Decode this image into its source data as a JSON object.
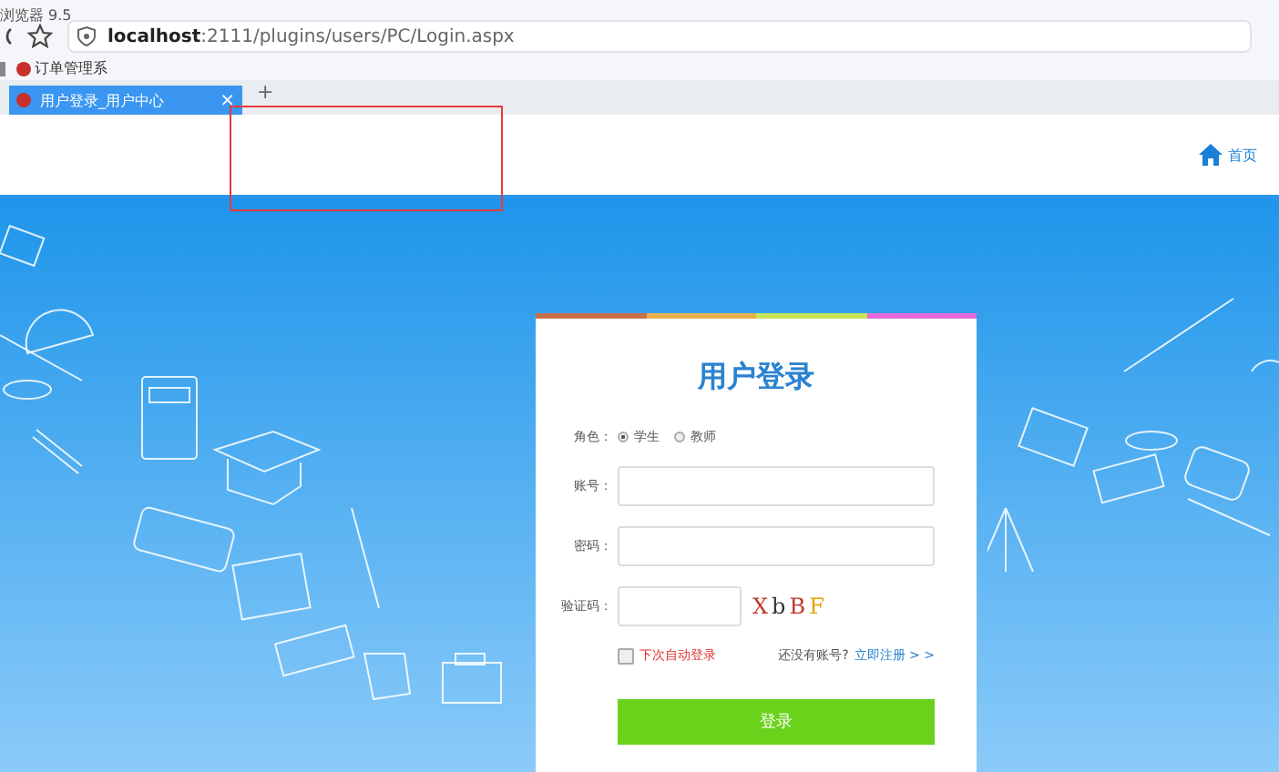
{
  "browser": {
    "title": "浏览器 9.5",
    "address": "**localhost**:2111/plugins/users/PC/Login.aspx",
    "bookmarks": [
      {
        "label": "订单管理系"
      }
    ],
    "tabs": [
      {
        "label": "用户登录_用户中心",
        "selected": true,
        "close": "×"
      }
    ],
    "new_tab": "+"
  },
  "header": {
    "home_link": "首页"
  },
  "login": {
    "title": "用户登录",
    "role": {
      "label": "角色：",
      "options": [
        {
          "label": "学生",
          "selected": true
        },
        {
          "label": "教师",
          "selected": false
        }
      ]
    },
    "fields": [
      {
        "label": "账号：",
        "kind": "text"
      },
      {
        "label": "密码：",
        "kind": "password"
      },
      {
        "label": "验证码：",
        "kind": "captcha",
        "captcha": "XbBF"
      }
    ],
    "remember": {
      "label": "下次自动登录",
      "checked": false
    },
    "register_prompt": "还没有账号?",
    "register_link": "立即注册 > >",
    "submit": "登录"
  }
}
